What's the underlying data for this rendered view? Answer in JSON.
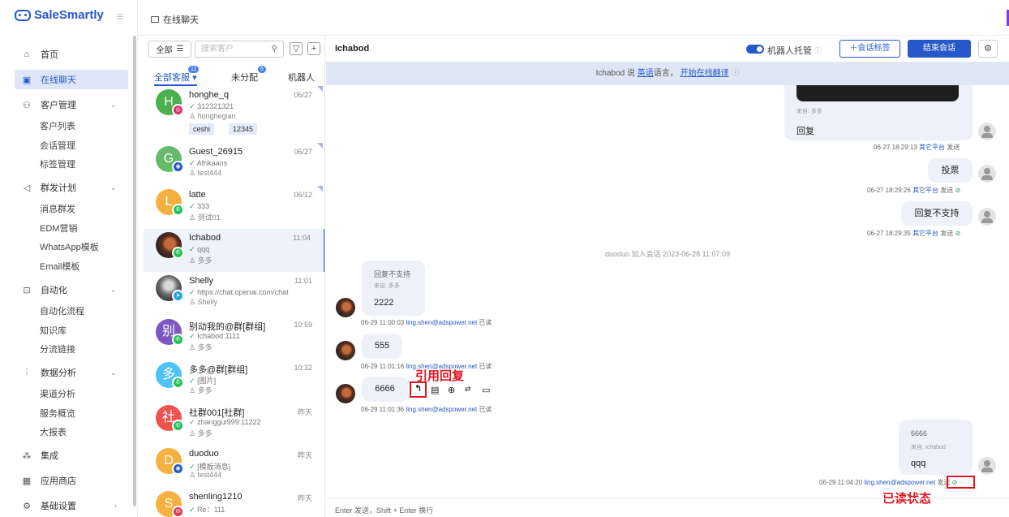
{
  "app": {
    "logo_text": "SaleSmartly",
    "top_tab": "在线聊天"
  },
  "sidebar": {
    "items": [
      {
        "label": "首页",
        "icon": "home-icon"
      },
      {
        "label": "在线聊天",
        "icon": "chat-icon"
      },
      {
        "label": "客户管理",
        "icon": "users-icon",
        "children": [
          "客户列表",
          "会话管理",
          "标签管理"
        ]
      },
      {
        "label": "群发计划",
        "icon": "send-icon",
        "children": [
          "消息群发",
          "EDM营销",
          "WhatsApp模板",
          "Email模板"
        ]
      },
      {
        "label": "自动化",
        "icon": "robot-icon",
        "children": [
          "自动化流程",
          "知识库",
          "分流链接"
        ]
      },
      {
        "label": "数据分析",
        "icon": "chart-icon",
        "children": [
          "渠道分析",
          "服务概览",
          "大报表"
        ]
      },
      {
        "label": "集成",
        "icon": "integration-icon"
      },
      {
        "label": "应用商店",
        "icon": "apps-icon"
      },
      {
        "label": "基础设置",
        "icon": "settings-icon"
      }
    ]
  },
  "convlist": {
    "filter_label": "全部",
    "search_placeholder": "搜索客户",
    "tabs": [
      {
        "label": "全部客服",
        "badge": "11"
      },
      {
        "label": "未分配",
        "badge": "6"
      },
      {
        "label": "机器人",
        "badge": ""
      }
    ],
    "items": [
      {
        "name": "honghe_q",
        "time": "06/27",
        "msg": "312321321",
        "agent": "honghegian",
        "avatar_letter": "H",
        "avatar_color": "#4caf50",
        "channel": "instagram",
        "tags": [
          "ceshi",
          "12345"
        ]
      },
      {
        "name": "Guest_26915",
        "time": "06/27",
        "msg": "Afrikaans",
        "agent": "test444",
        "avatar_letter": "G",
        "avatar_color": "#66bb6a",
        "channel": "web",
        "tags": []
      },
      {
        "name": "latte",
        "time": "06/12",
        "msg": "333",
        "agent": "测试01",
        "avatar_letter": "L",
        "avatar_color": "#f5b041",
        "channel": "whatsapp",
        "tags": []
      },
      {
        "name": "Ichabod",
        "time": "11:04",
        "msg": "qqq",
        "agent": "多多",
        "avatar_letter": "",
        "avatar_color": "#3b2a2a",
        "channel": "whatsapp",
        "tags": []
      },
      {
        "name": "Shelly",
        "time": "11:01",
        "msg": "https://chat.openai.com/chat",
        "agent": "Shelly",
        "avatar_letter": "",
        "avatar_color": "#8a8a8a",
        "channel": "telegram",
        "tags": []
      },
      {
        "name": "别动我的@群[群组]",
        "time": "10:59",
        "msg": "Ichabod:1111",
        "agent": "多多",
        "avatar_letter": "别",
        "avatar_color": "#7e57c2",
        "channel": "whatsapp",
        "tags": []
      },
      {
        "name": "多多@群[群组]",
        "time": "10:32",
        "msg": "[图片]",
        "agent": "多多",
        "avatar_letter": "多",
        "avatar_color": "#4fc3f7",
        "channel": "whatsapp",
        "tags": []
      },
      {
        "name": "社群001[社群]",
        "time": "昨天",
        "msg": "zhanggui999:11222",
        "agent": "多多",
        "avatar_letter": "社",
        "avatar_color": "#ef5350",
        "channel": "whatsapp",
        "tags": []
      },
      {
        "name": "duoduo",
        "time": "昨天",
        "msg": "[模板消息]",
        "agent": "test444",
        "avatar_letter": "D",
        "avatar_color": "#f5b041",
        "channel": "web",
        "tags": []
      },
      {
        "name": "shenling1210",
        "time": "昨天",
        "msg": "Re：111",
        "agent": "",
        "avatar_letter": "S",
        "avatar_color": "#f5b041",
        "channel": "email",
        "tags": []
      }
    ]
  },
  "chat": {
    "title": "Ichabod",
    "toggle_label": "机器人托管",
    "btn_tag": "＋会话标签",
    "btn_end": "结束会话",
    "banner": {
      "prefix": "Ichabod 说",
      "lang": "英语",
      "mid": "语言，",
      "link": "开始在线翻译"
    },
    "msg1": {
      "quote_src": "来自: 多多",
      "text": "回复",
      "meta_time": "06-27 18:29:13",
      "meta_platform": "其它平台",
      "meta_status": "发送"
    },
    "msg2": {
      "text": "投票",
      "meta_time": "06-27 18:29:26",
      "meta_platform": "其它平台",
      "meta_status": "发送"
    },
    "msg3": {
      "text": "回复不支持",
      "meta_time": "06-27 18:29:35",
      "meta_platform": "其它平台",
      "meta_status": "发送"
    },
    "system": "duoduo 加入会话 2023-06-28 11:07:09",
    "msg4": {
      "quote": "回复不支持",
      "quote_src": "来自: 多多",
      "text": "2222",
      "meta_time": "06-29 11:00:03",
      "meta_email": "ling.shen@adspower.net",
      "meta_status": "已读"
    },
    "msg5": {
      "text": "555",
      "meta_time": "06-29 11:01:16",
      "meta_email": "ling.shen@adspower.net",
      "meta_status": "已读"
    },
    "msg6": {
      "text": "6666",
      "meta_time": "06-29 11:01:36",
      "meta_email": "ling.shen@adspower.net",
      "meta_status": "已读"
    },
    "msg7": {
      "quote": "6666",
      "quote_src": "来自: Ichabod",
      "text": "qqq",
      "meta_time": "06-29 11:04:20",
      "meta_email": "ling.shen@adspower.net",
      "meta_status": "发送"
    },
    "annot_quote": "引用回复",
    "annot_read": "已读状态",
    "input_hint": "Enter 发送，Shift + Enter 换行"
  }
}
